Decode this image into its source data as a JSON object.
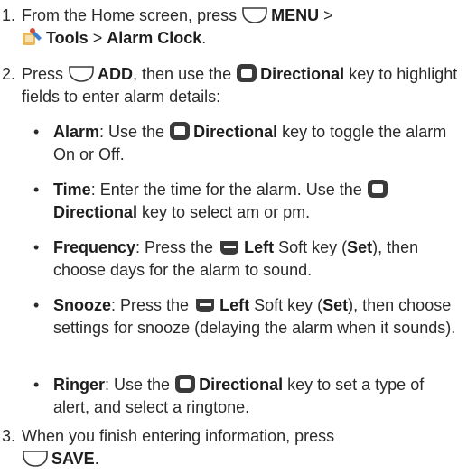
{
  "step1": {
    "num": "1.",
    "a": "From the Home screen, press",
    "menu": "MENU",
    "gt1": ">",
    "tools": "Tools",
    "gt2": ">",
    "alarm_clock": "Alarm Clock",
    "end": "."
  },
  "step2": {
    "num": "2.",
    "a": "Press",
    "add": "ADD",
    "b": ", then use the",
    "directional": "Directional",
    "c": "key to highlight fields to enter alarm details:"
  },
  "bullets": {
    "alarm": {
      "label": "Alarm",
      "a": ": Use the",
      "directional": "Directional",
      "b": "key to toggle the alarm On or Off."
    },
    "time": {
      "label": "Time",
      "a": ": Enter the time for the alarm. Use the",
      "directional": "Directional",
      "b": "key to select am or pm."
    },
    "frequency": {
      "label": "Frequency",
      "a": ": Press the",
      "left": "Left",
      "b": "Soft key (",
      "set": "Set",
      "c": "), then choose days for the alarm to sound."
    },
    "snooze": {
      "label": "Snooze",
      "a": ": Press the",
      "left": "Left",
      "b": "Soft key (",
      "set": "Set",
      "c": "), then choose settings for snooze (delaying the alarm when it sounds)."
    },
    "ringer": {
      "label": "Ringer",
      "a": ": Use the",
      "directional": "Directional",
      "b": "key to set a type of alert, and select a ringtone."
    }
  },
  "step3": {
    "num": "3.",
    "a": "When you finish entering information, press",
    "save": "SAVE",
    "end": "."
  },
  "icons": {
    "softkey": "softkey-icon",
    "directional": "directional-key-icon",
    "left_softkey": "left-softkey-icon",
    "tools": "tools-icon"
  },
  "colors": {
    "text": "#2a2a2a",
    "key_fill": "#3a3a3a",
    "key_light": "#f4f4f4"
  }
}
